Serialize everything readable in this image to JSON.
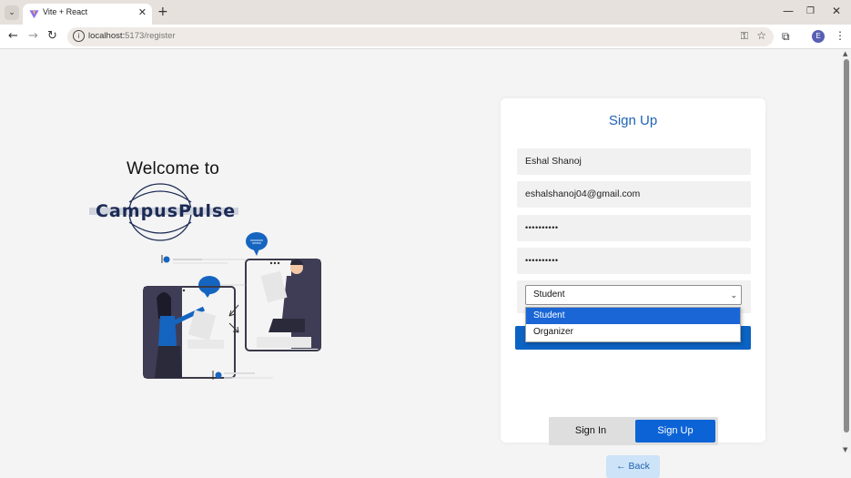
{
  "browser": {
    "tab_title": "Vite + React",
    "url_host": "localhost:",
    "url_rest": "5173/register",
    "profile_initial": "E"
  },
  "left": {
    "welcome": "Welcome to",
    "logo_text": "CampusPulse"
  },
  "form": {
    "title": "Sign Up",
    "name_value": "Eshal Shanoj",
    "email_value": "eshalshanoj04@gmail.com",
    "password_value": "••••••••••",
    "confirm_password_value": "••••••••••",
    "role_selected": "Student",
    "role_options": [
      "Student",
      "Organizer"
    ],
    "toggle_signin": "Sign In",
    "toggle_signup": "Sign Up",
    "back_label": "Back"
  },
  "colors": {
    "accent": "#0b63d6",
    "title": "#1e63b3",
    "back_bg": "#cde3f7"
  }
}
